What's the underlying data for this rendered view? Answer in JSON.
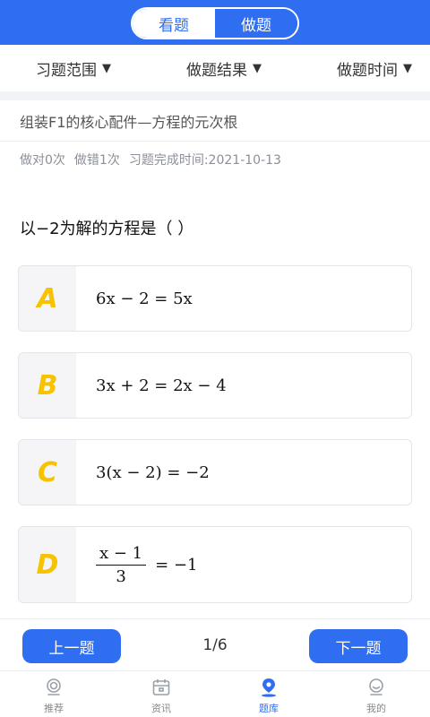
{
  "header": {
    "tabs": [
      {
        "label": "看题",
        "active": false
      },
      {
        "label": "做题",
        "active": true
      }
    ],
    "accent_color": "#2f6ef0"
  },
  "filters": [
    {
      "label": "习题范围",
      "icon": "triangle-down-icon"
    },
    {
      "label": "做题结果",
      "icon": "triangle-down-icon"
    },
    {
      "label": "做题时间",
      "icon": "triangle-down-icon"
    }
  ],
  "chapter": "组装F1的核心配件—方程的元次根",
  "stats": {
    "correct": "做对0次",
    "wrong": "做错1次",
    "completed": "习题完成时间:2021-10-13"
  },
  "question": "以−2为解的方程是（   ）",
  "options": [
    {
      "letter": "A",
      "text": "6x − 2 = 5x"
    },
    {
      "letter": "B",
      "text": "3x + 2 = 2x − 4"
    },
    {
      "letter": "C",
      "text": "3(x − 2) = −2"
    },
    {
      "letter": "D",
      "numerator": "x − 1",
      "denominator": "3",
      "rhs": "= −1"
    }
  ],
  "pager": {
    "prev_label": "上一题",
    "next_label": "下一题",
    "position": "1/6"
  },
  "tabbar": [
    {
      "label": "推荐",
      "icon": "badge-icon",
      "active": false
    },
    {
      "label": "资讯",
      "icon": "calendar-icon",
      "active": false
    },
    {
      "label": "题库",
      "icon": "location-pin-icon",
      "active": true
    },
    {
      "label": "我的",
      "icon": "profile-icon",
      "active": false
    }
  ]
}
